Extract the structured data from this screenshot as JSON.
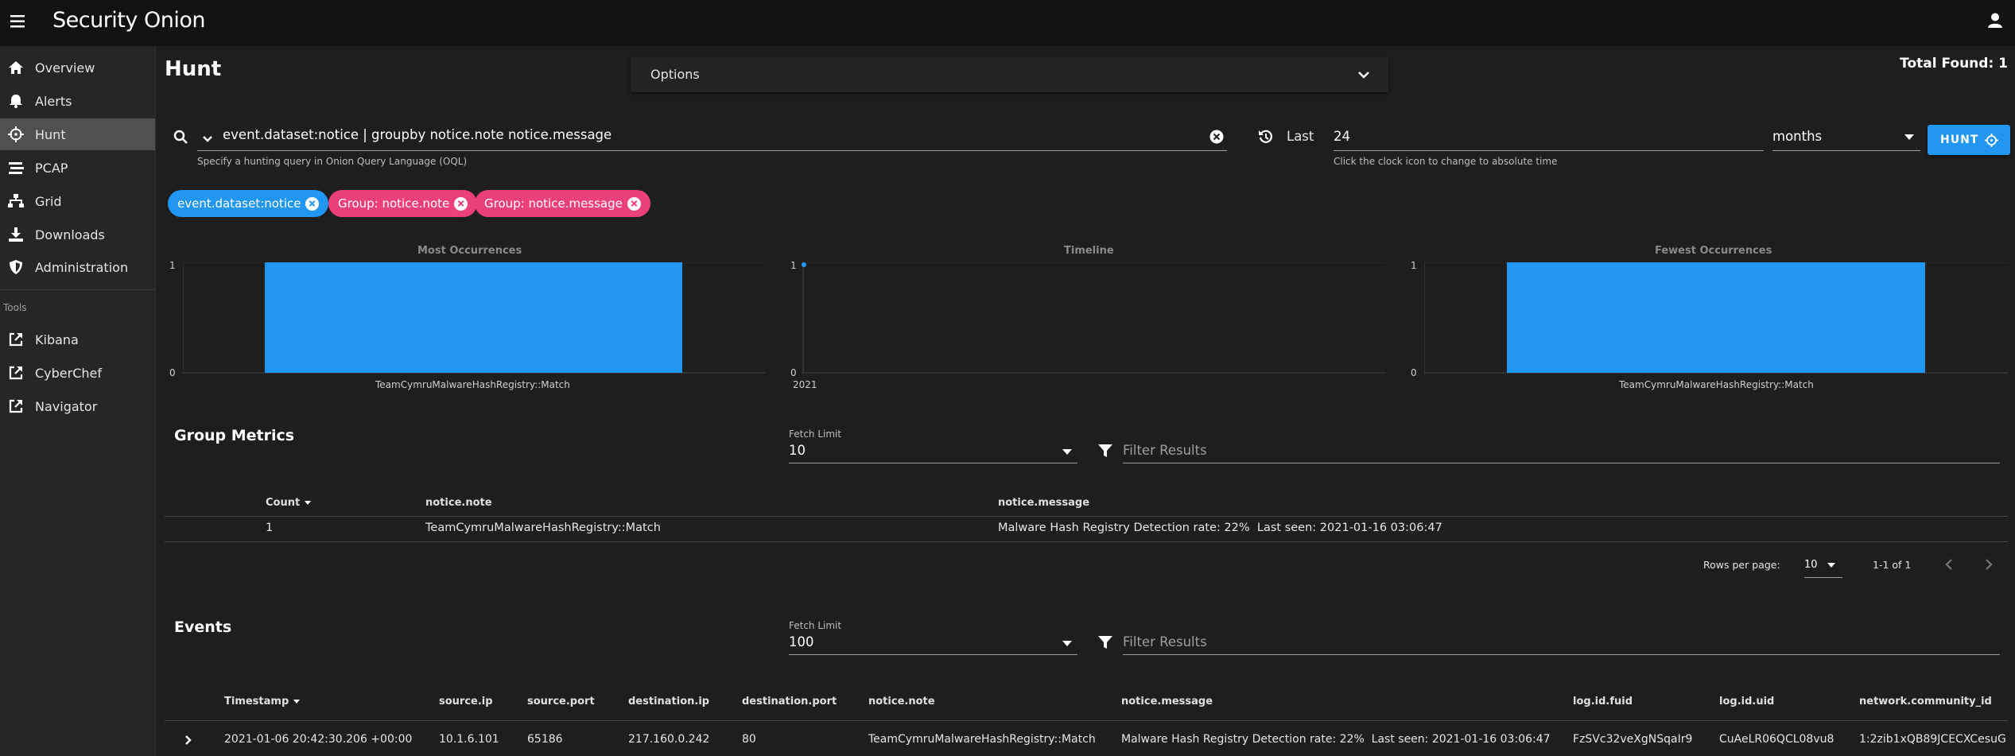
{
  "app": {
    "brand": "Security Onion"
  },
  "sidebar": {
    "items": [
      {
        "label": "Overview",
        "icon": "home-icon"
      },
      {
        "label": "Alerts",
        "icon": "bell-icon"
      },
      {
        "label": "Hunt",
        "icon": "crosshairs-icon"
      },
      {
        "label": "PCAP",
        "icon": "stream-icon"
      },
      {
        "label": "Grid",
        "icon": "sitemap-icon"
      },
      {
        "label": "Downloads",
        "icon": "download-icon"
      },
      {
        "label": "Administration",
        "icon": "shield-icon"
      }
    ],
    "tools_label": "Tools",
    "tools": [
      {
        "label": "Kibana",
        "icon": "external-link-icon"
      },
      {
        "label": "CyberChef",
        "icon": "external-link-icon"
      },
      {
        "label": "Navigator",
        "icon": "external-link-icon"
      }
    ]
  },
  "page": {
    "title": "Hunt",
    "options_label": "Options",
    "total_found": "Total Found: 1"
  },
  "query": {
    "value": "event.dataset:notice | groupby notice.note notice.message",
    "hint": "Specify a hunting query in Onion Query Language (OQL)",
    "last_label": "Last",
    "last_value": "24",
    "unit": "months",
    "time_hint": "Click the clock icon to change to absolute time",
    "hunt_button": "HUNT"
  },
  "chips": [
    "event.dataset:notice",
    "Group: notice.note",
    "Group: notice.message"
  ],
  "charts": {
    "most": {
      "title": "Most Occurrences",
      "ymin": "0",
      "ymax": "1",
      "label": "TeamCymruMalwareHashRegistry::Match"
    },
    "timeline": {
      "title": "Timeline",
      "ymin": "0",
      "ymax": "1",
      "label": "2021"
    },
    "fewest": {
      "title": "Fewest Occurrences",
      "ymin": "0",
      "ymax": "1",
      "label": "TeamCymruMalwareHashRegistry::Match"
    }
  },
  "chart_data": [
    {
      "type": "bar",
      "title": "Most Occurrences",
      "categories": [
        "TeamCymruMalwareHashRegistry::Match"
      ],
      "values": [
        1
      ],
      "ylim": [
        0,
        1
      ]
    },
    {
      "type": "line",
      "title": "Timeline",
      "x": [
        "2021"
      ],
      "values": [
        1
      ],
      "ylim": [
        0,
        1
      ]
    },
    {
      "type": "bar",
      "title": "Fewest Occurrences",
      "categories": [
        "TeamCymruMalwareHashRegistry::Match"
      ],
      "values": [
        1
      ],
      "ylim": [
        0,
        1
      ]
    }
  ],
  "group_metrics": {
    "title": "Group Metrics",
    "fetch_label": "Fetch Limit",
    "fetch_value": "10",
    "filter_placeholder": "Filter Results",
    "columns": [
      "Count",
      "notice.note",
      "notice.message"
    ],
    "rows": [
      [
        "1",
        "TeamCymruMalwareHashRegistry::Match",
        "Malware Hash Registry Detection rate: 22%  Last seen: 2021-01-16 03:06:47"
      ]
    ],
    "rows_per_page_label": "Rows per page:",
    "rows_per_page": "10",
    "range": "1-1 of 1"
  },
  "events": {
    "title": "Events",
    "fetch_label": "Fetch Limit",
    "fetch_value": "100",
    "filter_placeholder": "Filter Results",
    "columns": [
      "Timestamp",
      "source.ip",
      "source.port",
      "destination.ip",
      "destination.port",
      "notice.note",
      "notice.message",
      "log.id.fuid",
      "log.id.uid",
      "network.community_id"
    ],
    "row": [
      "2021-01-06 20:42:30.206 +00:00",
      "10.1.6.101",
      "65186",
      "217.160.0.242",
      "80",
      "TeamCymruMalwareHashRegistry::Match",
      "Malware Hash Registry Detection rate: 22%  Last seen: 2021-01-16 03:06:47",
      "FzSVc32veXgNSqaIr9",
      "CuAeLR06QCL08vu8",
      "1:2zib1xQB89JCECXCesuG"
    ]
  },
  "colors": {
    "accent": "#2196f3",
    "chip_pink": "#ec407a",
    "bar": "#2196f3"
  }
}
